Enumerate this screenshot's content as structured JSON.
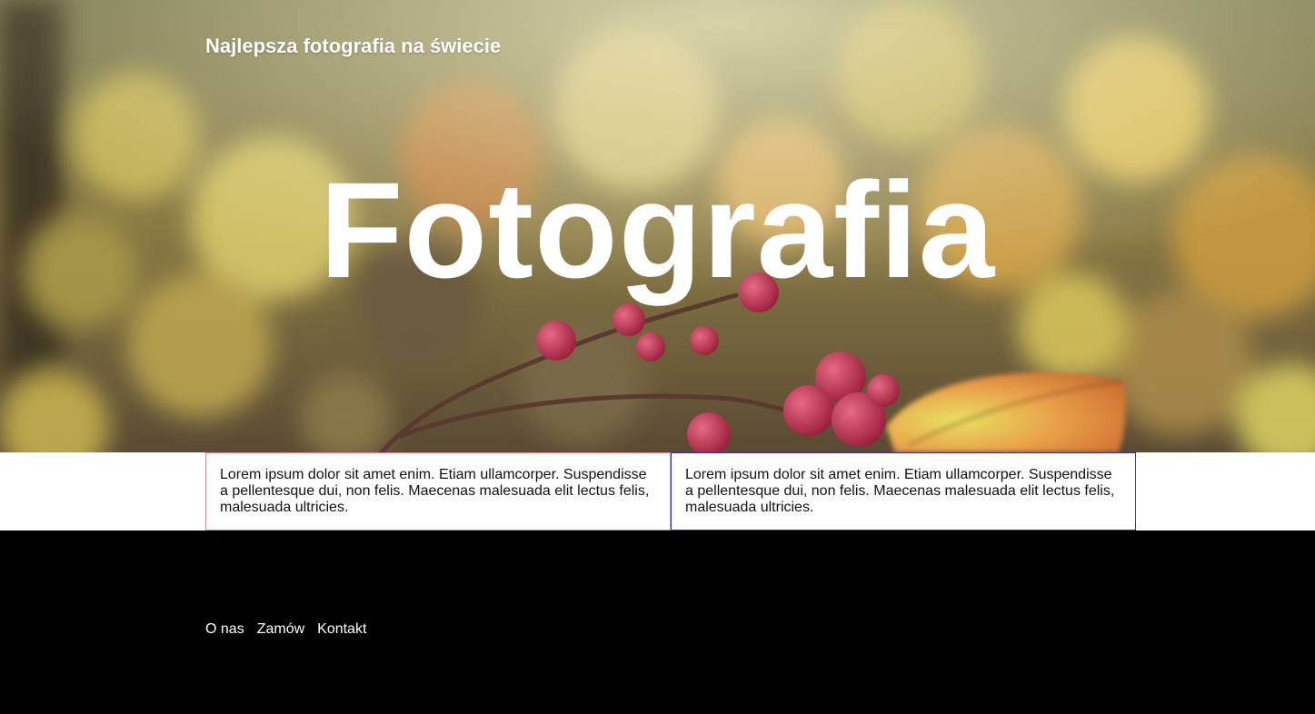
{
  "hero": {
    "subtitle": "Najlepsza fotografia na świecie",
    "title": "Fotografia"
  },
  "content": {
    "left_text": "Lorem ipsum dolor sit amet enim. Etiam ullamcorper. Suspendisse a pellentesque dui, non felis. Maecenas malesuada elit lectus felis, malesuada ultricies.",
    "right_text": "Lorem ipsum dolor sit amet enim. Etiam ullamcorper. Suspendisse a pellentesque dui, non felis. Maecenas malesuada elit lectus felis, malesuada ultricies."
  },
  "footer": {
    "nav": [
      "O nas",
      "Zamów",
      "Kontakt"
    ]
  },
  "colors": {
    "left_box_border": "#e58a9a",
    "right_box_border": "#3b33a8",
    "footer_bg": "#000000",
    "hero_text": "#ffffff"
  }
}
